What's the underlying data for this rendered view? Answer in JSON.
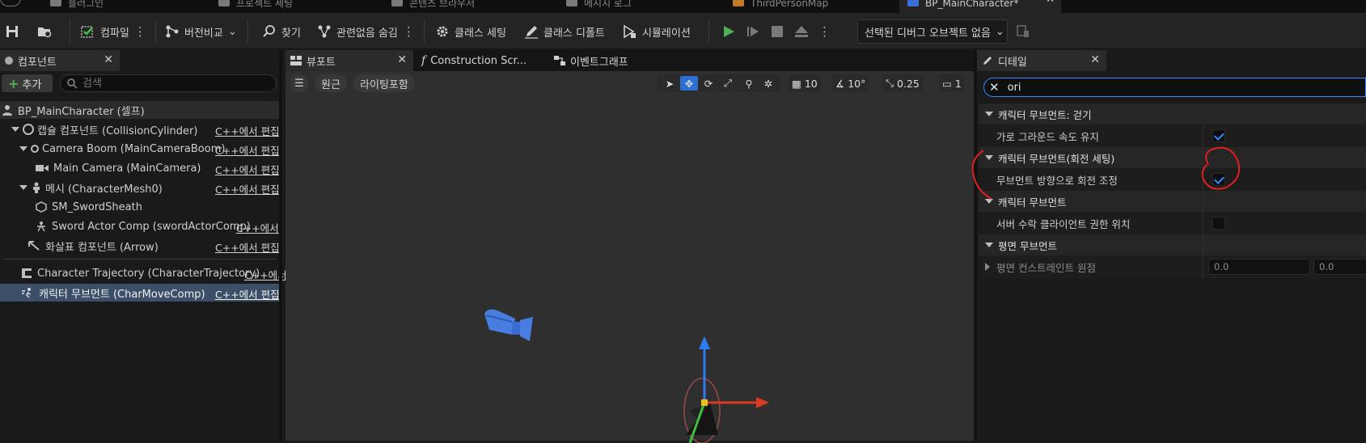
{
  "doc_tabs": [
    "플러그인",
    "프로젝트 세팅",
    "콘텐츠 브라우저",
    "메시지 로그",
    "ThirdPersonMap",
    "BP_MainCharacter*"
  ],
  "toolbar": {
    "compile": "컴파일",
    "diff": "버전비교",
    "find": "찾기",
    "hide_unrelated": "관련없음 숨김",
    "class_settings": "클래스 세팅",
    "class_defaults": "클래스 디폴트",
    "simulation": "시뮬레이션",
    "debug_object": "선택된 디버그 오브젝트 없음"
  },
  "components": {
    "title": "컴포넌트",
    "add": "추가",
    "search_placeholder": "검색",
    "root": "BP_MainCharacter (셀프)",
    "edit_label": "C++에서 편집",
    "edit_label_trunc": "C++에서 ",
    "edit_label_trunc2": "C++에서",
    "items": [
      {
        "label": "캡슐 컴포넌트 (CollisionCylinder)"
      },
      {
        "label": "Camera Boom (MainCameraBoom)"
      },
      {
        "label": "Main Camera (MainCamera)"
      },
      {
        "label": "메시 (CharacterMesh0)"
      },
      {
        "label": "SM_SwordSheath"
      },
      {
        "label": "Sword Actor Comp (swordActorComp)"
      },
      {
        "label": "화살표 컴포넌트 (Arrow)"
      },
      {
        "label": "Character Trajectory (CharacterTrajectory)"
      },
      {
        "label": "캐릭터 무브먼트 (CharMoveComp)"
      }
    ]
  },
  "center_tabs": {
    "viewport": "뷰포트",
    "construction": "Construction Scr...",
    "event_graph": "이벤트그래프"
  },
  "viewport": {
    "perspective": "원근",
    "lit": "라이팅포함",
    "grid": "10",
    "angle": "10°",
    "scale": "0.25",
    "camera_speed": "1"
  },
  "details": {
    "title": "디테일",
    "search_value": "ori",
    "categories": [
      {
        "label": "캐릭터 무브먼트: 걷기",
        "prop": "가로 그라운드 속도 유지",
        "checked": true
      },
      {
        "label": "캐릭터 무브먼트(회전 세팅)",
        "prop": "무브먼트 방향으로 회전 조정",
        "checked": true
      },
      {
        "label": "캐릭터 무브먼트",
        "prop": "서버 수락 클라이언트 권한 위치",
        "checked": false
      },
      {
        "label": "평면 무브먼트",
        "prop": "평면 컨스트레인트 원점",
        "x": "0.0",
        "y": "0.0"
      }
    ]
  },
  "colors": {
    "accent": "#2d8cff",
    "annotation": "#e02020",
    "play": "#4caf50"
  }
}
